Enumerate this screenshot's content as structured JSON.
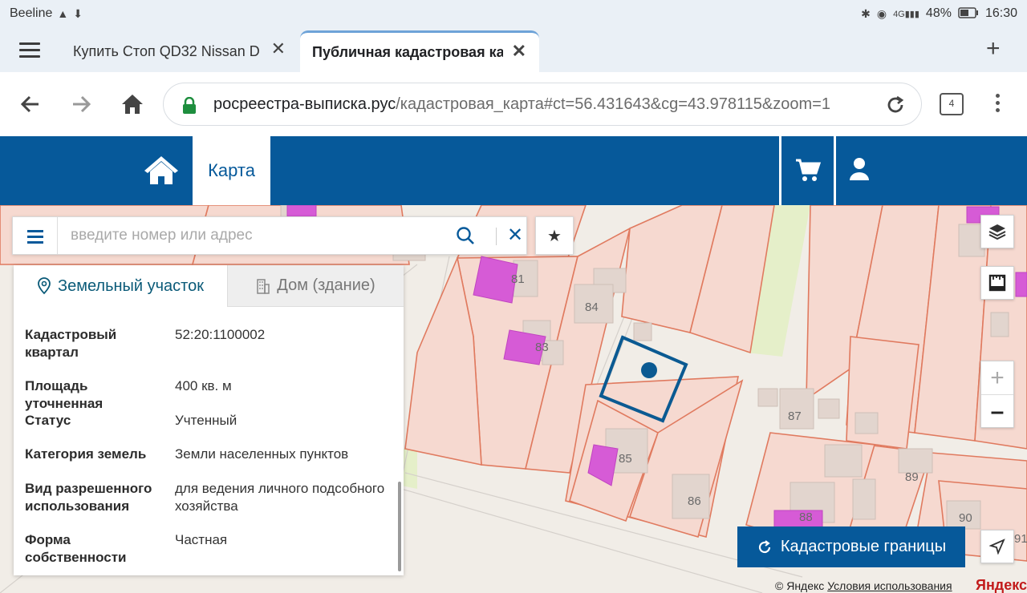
{
  "status_bar": {
    "carrier": "Beeline",
    "battery": "48%",
    "time": "16:30",
    "network": "4G"
  },
  "tabs": [
    {
      "title": "Купить Стоп QD32 Nissan D",
      "active": false
    },
    {
      "title": "Публичная кадастровая ка",
      "active": true
    }
  ],
  "address_bar": {
    "domain": "росреестра-выписка.рус",
    "path": "/кадастровая_карта#ct=56.431643&cg=43.978115&zoom=1",
    "tab_count": "4"
  },
  "site_header": {
    "map_tab": "Карта"
  },
  "search": {
    "placeholder": "введите номер или адрес"
  },
  "panel": {
    "tabs": [
      {
        "label": "Земельный участок",
        "active": true
      },
      {
        "label": "Дом (здание)",
        "active": false
      }
    ],
    "rows": [
      {
        "label": "Кадастровый квартал",
        "value": "52:20:1100002"
      },
      {
        "label": "Площадь уточненная",
        "value": "400 кв. м"
      },
      {
        "label": "Статус",
        "value": "Учтенный"
      },
      {
        "label": "Категория земель",
        "value": "Земли населенных пунктов"
      },
      {
        "label": "Вид разрешенного использования",
        "value": "для ведения личного подсобного хозяйства"
      },
      {
        "label": "Форма собственности",
        "value": "Частная"
      }
    ]
  },
  "map": {
    "house_numbers": [
      "81",
      "83",
      "84",
      "85",
      "86",
      "87",
      "88",
      "89",
      "90",
      "91"
    ],
    "cadastral_button": "Кадастровые границы",
    "copyright": "© Яндекс",
    "terms": "Условия использования",
    "logo": "Яндекс"
  },
  "colors": {
    "brand": "#06599a",
    "parcel_fill": "#f6d9d0",
    "parcel_border": "#e07a5f",
    "building_pink": "#d65bd6",
    "building_grey": "#e0d4cd",
    "selection": "#0b5a92"
  }
}
